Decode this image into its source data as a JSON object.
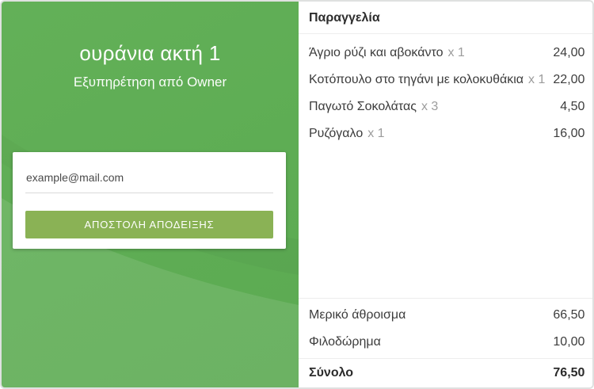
{
  "left_panel": {
    "venue_title": "ουράνια ακτή 1",
    "service_line": "Εξυπηρέτηση από Owner",
    "email_placeholder": "example@mail.com",
    "send_button_label": "ΑΠΟΣΤΟΛΗ ΑΠΟΔΕΙΞΗΣ",
    "colors": {
      "background_green": "#5ead54",
      "background_green_light": "#6ab75e",
      "button_green": "#8ab255"
    }
  },
  "order_panel": {
    "header": "Παραγγελία",
    "items": [
      {
        "name": "Άγριο ρύζι και αβοκάντο",
        "quantity": "x 1",
        "price": "24,00"
      },
      {
        "name": "Κοτόπουλο στο τηγάνι με κολοκυθάκια",
        "quantity": "x 1",
        "price": "22,00"
      },
      {
        "name": "Παγωτό Σοκολάτας",
        "quantity": "x 3",
        "price": "4,50"
      },
      {
        "name": "Ρυζόγαλο",
        "quantity": "x 1",
        "price": "16,00"
      }
    ],
    "summary": {
      "subtotal_label": "Μερικό άθροισμα",
      "subtotal_value": "66,50",
      "tip_label": "Φιλοδώρημα",
      "tip_value": "10,00",
      "total_label": "Σύνολο",
      "total_value": "76,50"
    }
  }
}
